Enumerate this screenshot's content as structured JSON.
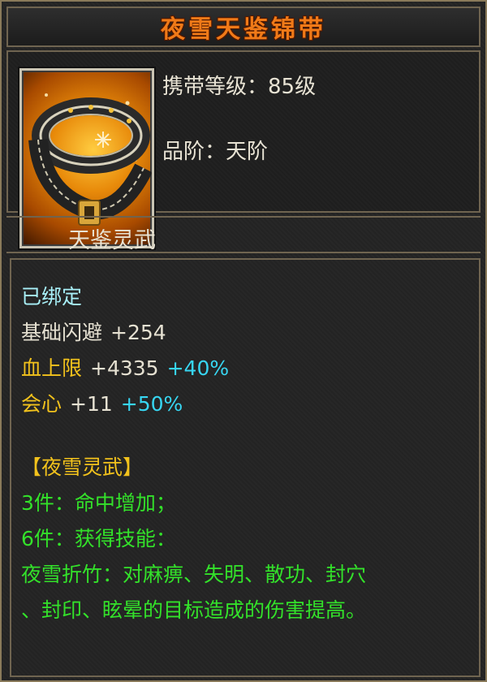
{
  "item": {
    "name": "夜雪天鉴锦带",
    "level_label": "携带等级：",
    "level_value": "85级",
    "grade_label": "品阶：",
    "grade_value": "天阶",
    "category": "天鉴灵武",
    "icon": "belt-icon"
  },
  "attributes": {
    "bound": "已绑定",
    "stats": [
      {
        "name": "基础闪避",
        "value": "+254",
        "bonus": ""
      },
      {
        "name": "血上限",
        "value": "+4335",
        "bonus": "+40%"
      },
      {
        "name": "会心",
        "value": "+11",
        "bonus": "+50%"
      }
    ]
  },
  "set_bonus": {
    "title": "【夜雪灵武】",
    "piece3": "3件：命中增加；",
    "piece6": "6件：获得技能：",
    "skill_line1": "夜雪折竹：对麻痹、失明、散功、封穴",
    "skill_line2": "、封印、眩晕的目标造成的伤害提高。"
  },
  "colors": {
    "title": "#f07a18",
    "bound": "#a8f0f8",
    "gold": "#f2c21c",
    "cyan": "#37d6f2",
    "green": "#33e12a",
    "border": "#6f6450"
  }
}
